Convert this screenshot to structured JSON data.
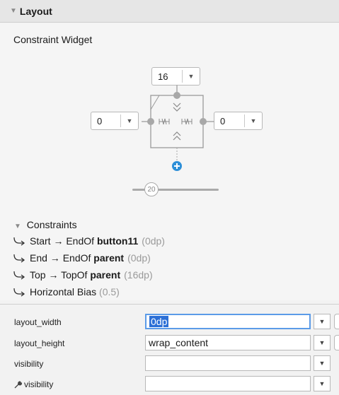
{
  "section": {
    "title": "Layout"
  },
  "widget": {
    "title": "Constraint Widget",
    "top_margin": "16",
    "start_margin": "0",
    "end_margin": "0",
    "bias_value": "20"
  },
  "constraints": {
    "header": "Constraints",
    "rows": [
      {
        "prefix": "Start → EndOf ",
        "target": "button11",
        "value": "(0dp)"
      },
      {
        "prefix": "End → EndOf ",
        "target": "parent",
        "value": "(0dp)"
      },
      {
        "prefix": "Top → TopOf ",
        "target": "parent",
        "value": "(16dp)"
      },
      {
        "prefix": "Horizontal Bias ",
        "target": "",
        "value": "(0.5)"
      }
    ]
  },
  "attributes": [
    {
      "label": "layout_width",
      "value": "0dp"
    },
    {
      "label": "layout_height",
      "value": "wrap_content"
    },
    {
      "label": "visibility",
      "value": ""
    },
    {
      "label": "visibility",
      "value": ""
    }
  ],
  "colors": {
    "accent": "#2d8fd8",
    "selection": "#2b6fd6",
    "handle": "#a8a8a8"
  },
  "icons": [
    "collapse-triangle-icon",
    "constraint-icon",
    "dropdown-arrow-icon",
    "add-constraint-icon",
    "wrench-icon"
  ]
}
